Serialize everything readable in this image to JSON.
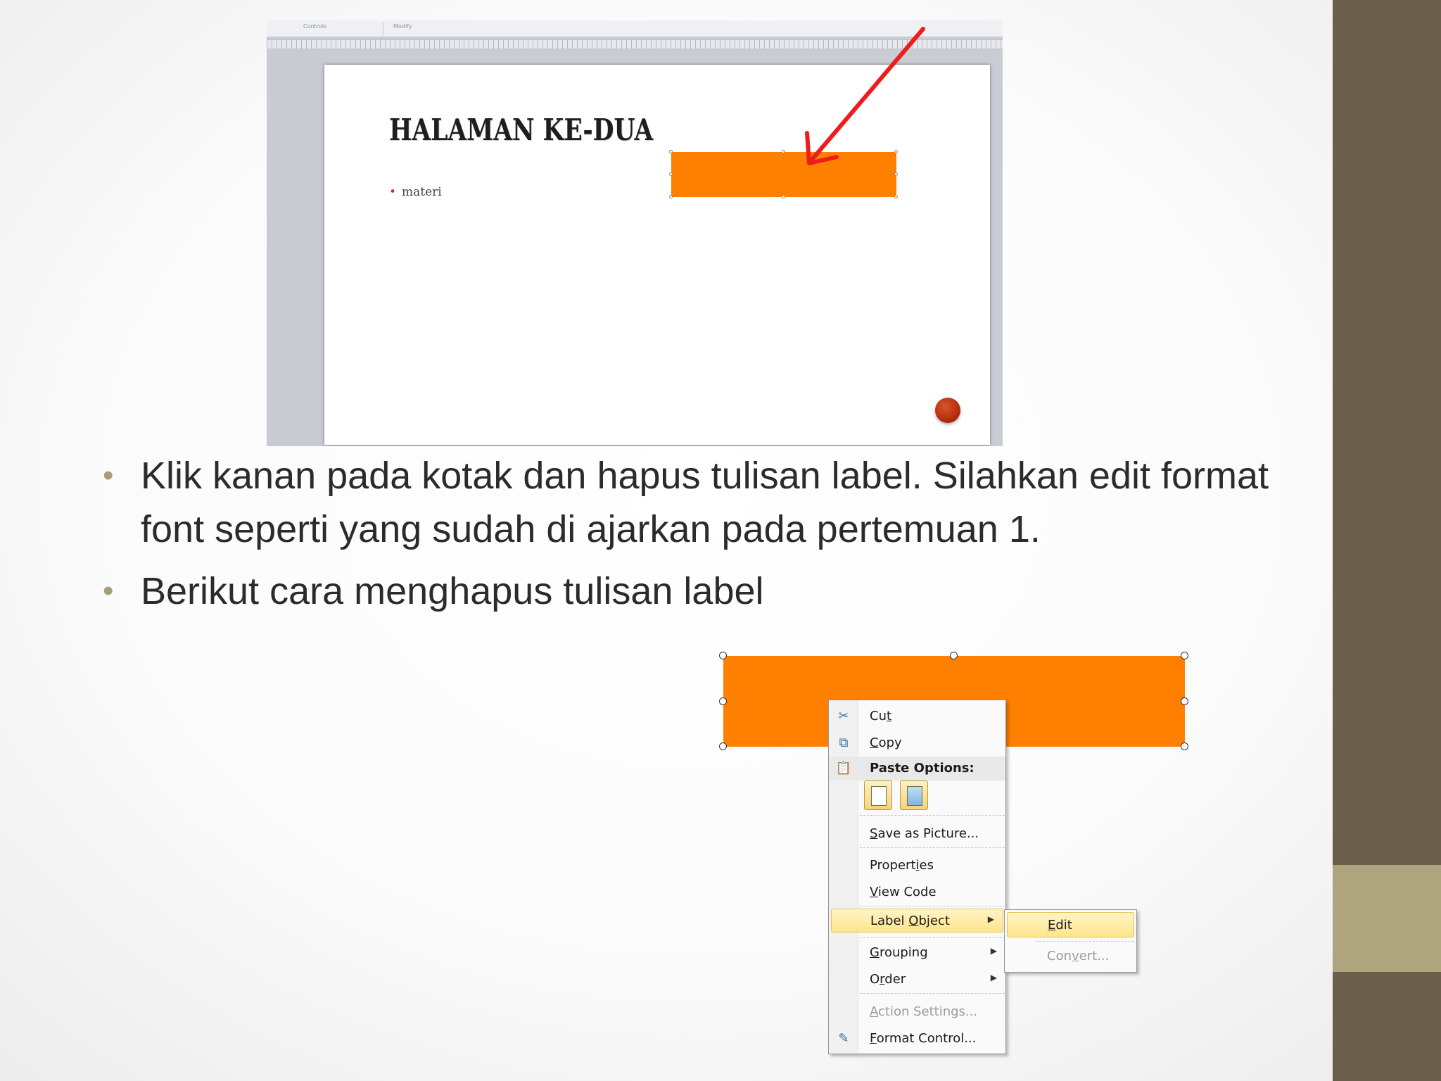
{
  "colors": {
    "side_bar": "#695f4b",
    "side_accent": "#aea47d",
    "orange_box": "#ff8000",
    "arrow": "#ee1c1c",
    "bullet_mark": "#a79e78"
  },
  "top_screenshot": {
    "ribbon_groups": [
      "Controls",
      "Modify"
    ],
    "slide_title": "HALAMAN KE-DUA",
    "slide_bullet": "materi"
  },
  "bullets": [
    {
      "mark": "•",
      "text": "Klik kanan pada kotak dan hapus tulisan label. Silahkan edit format font seperti yang sudah di ajarkan pada pertemuan 1."
    },
    {
      "mark": "•",
      "text": "Berikut cara menghapus tulisan label"
    }
  ],
  "context_menu": {
    "cut": {
      "pre": "Cu",
      "key": "t",
      "post": "",
      "icon": "scissors-icon"
    },
    "copy": {
      "pre": "",
      "key": "C",
      "post": "opy",
      "icon": "copy-icon"
    },
    "paste_options": {
      "label": "Paste Options:",
      "icon": "paste-icon"
    },
    "save_as_picture": {
      "pre": "",
      "key": "S",
      "post": "ave as Picture..."
    },
    "properties": {
      "pre": "Propert",
      "key": "i",
      "post": "es"
    },
    "view_code": {
      "pre": "",
      "key": "V",
      "post": "iew Code"
    },
    "label_object": {
      "pre": "Label ",
      "key": "O",
      "post": "bject"
    },
    "grouping": {
      "pre": "",
      "key": "G",
      "post": "rouping"
    },
    "order": {
      "pre": "O",
      "key": "r",
      "post": "der"
    },
    "action_settings": {
      "pre": "",
      "key": "A",
      "post": "ction Settings..."
    },
    "format_control": {
      "pre": "",
      "key": "F",
      "post": "ormat Control...",
      "icon": "format-control-icon"
    }
  },
  "submenu": {
    "edit": {
      "pre": "",
      "key": "E",
      "post": "dit"
    },
    "convert": {
      "pre": "Con",
      "key": "v",
      "post": "ert..."
    }
  }
}
